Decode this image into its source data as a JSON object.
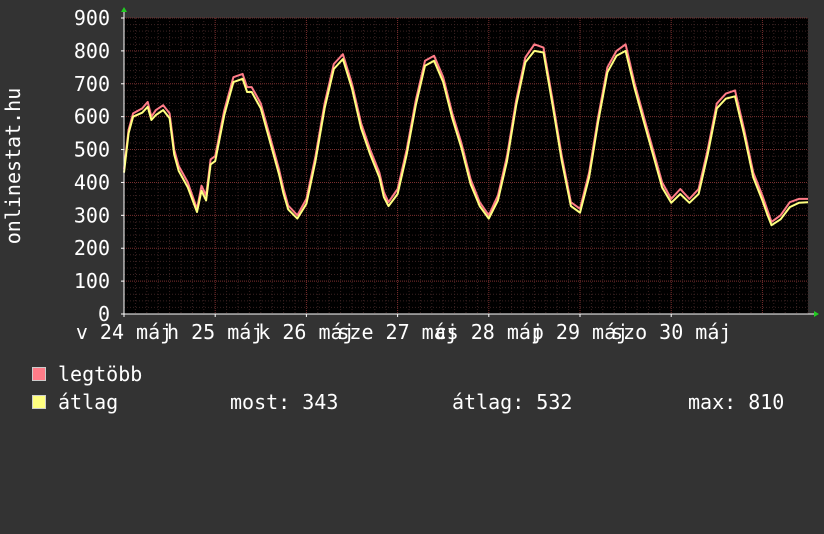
{
  "site_label": "onlinestat.hu",
  "colors": {
    "background": "#333333",
    "plot_background": "#000000",
    "grid": "#4a2626",
    "axis": "#ffffff",
    "max_line": "#ff7c88",
    "avg_line": "#ffff80"
  },
  "legend": [
    {
      "name": "legtöbb",
      "color": "#ff7c88"
    },
    {
      "name": "átlag",
      "color": "#ffff80"
    }
  ],
  "stats": {
    "now": "most: 343",
    "avg": "átlag: 532",
    "max": "max: 810"
  },
  "chart_data": {
    "type": "line",
    "title": "",
    "xlabel": "",
    "ylabel": "onlinestat.hu",
    "ylim": [
      0,
      900
    ],
    "yticks": [
      0,
      100,
      200,
      300,
      400,
      500,
      600,
      700,
      800,
      900
    ],
    "x_day_range": [
      0,
      7.5
    ],
    "xtick_labels": [
      {
        "x": 0,
        "label": "v 24 máj"
      },
      {
        "x": 1,
        "label": "h 25 máj"
      },
      {
        "x": 2,
        "label": "k 26 máj"
      },
      {
        "x": 3,
        "label": "sze 27 máj"
      },
      {
        "x": 4,
        "label": "cs 28 máj"
      },
      {
        "x": 5,
        "label": "p 29 máj"
      },
      {
        "x": 6,
        "label": "szo 30 máj"
      }
    ],
    "grid": true,
    "legend_position": "bottom-left",
    "series": [
      {
        "name": "legtöbb",
        "color": "#ff7c88",
        "x": [
          0.0,
          0.05,
          0.1,
          0.2,
          0.26,
          0.3,
          0.35,
          0.43,
          0.5,
          0.55,
          0.6,
          0.7,
          0.8,
          0.85,
          0.9,
          0.95,
          1.0,
          1.1,
          1.2,
          1.3,
          1.35,
          1.4,
          1.5,
          1.6,
          1.7,
          1.75,
          1.8,
          1.9,
          2.0,
          2.1,
          2.2,
          2.3,
          2.4,
          2.5,
          2.6,
          2.7,
          2.8,
          2.85,
          2.9,
          3.0,
          3.1,
          3.2,
          3.3,
          3.4,
          3.5,
          3.6,
          3.7,
          3.8,
          3.9,
          4.0,
          4.1,
          4.2,
          4.3,
          4.4,
          4.5,
          4.6,
          4.7,
          4.8,
          4.9,
          5.0,
          5.1,
          5.2,
          5.3,
          5.4,
          5.5,
          5.6,
          5.7,
          5.8,
          5.9,
          6.0,
          6.1,
          6.2,
          6.3,
          6.4,
          6.5,
          6.6,
          6.7,
          6.8,
          6.9,
          7.0,
          7.05,
          7.1,
          7.2,
          7.3,
          7.4,
          7.5
        ],
        "y": [
          440,
          560,
          610,
          625,
          645,
          600,
          620,
          635,
          610,
          500,
          450,
          400,
          320,
          390,
          360,
          470,
          480,
          620,
          720,
          730,
          690,
          690,
          640,
          540,
          440,
          380,
          330,
          300,
          350,
          480,
          640,
          760,
          790,
          700,
          580,
          500,
          430,
          370,
          340,
          380,
          500,
          650,
          770,
          785,
          720,
          610,
          520,
          410,
          340,
          300,
          360,
          480,
          650,
          780,
          820,
          810,
          650,
          480,
          340,
          320,
          430,
          600,
          750,
          800,
          820,
          700,
          600,
          500,
          400,
          350,
          380,
          350,
          380,
          500,
          640,
          670,
          680,
          560,
          430,
          360,
          320,
          280,
          300,
          340,
          350,
          350
        ]
      },
      {
        "name": "átlag",
        "color": "#ffff80",
        "x": [
          0.0,
          0.05,
          0.1,
          0.2,
          0.26,
          0.3,
          0.35,
          0.43,
          0.5,
          0.55,
          0.6,
          0.7,
          0.8,
          0.85,
          0.9,
          0.95,
          1.0,
          1.1,
          1.2,
          1.3,
          1.35,
          1.4,
          1.5,
          1.6,
          1.7,
          1.75,
          1.8,
          1.9,
          2.0,
          2.1,
          2.2,
          2.3,
          2.4,
          2.5,
          2.6,
          2.7,
          2.8,
          2.85,
          2.9,
          3.0,
          3.1,
          3.2,
          3.3,
          3.4,
          3.5,
          3.6,
          3.7,
          3.8,
          3.9,
          4.0,
          4.1,
          4.2,
          4.3,
          4.4,
          4.5,
          4.6,
          4.7,
          4.8,
          4.9,
          5.0,
          5.1,
          5.2,
          5.3,
          5.4,
          5.5,
          5.6,
          5.7,
          5.8,
          5.9,
          6.0,
          6.1,
          6.2,
          6.3,
          6.4,
          6.5,
          6.6,
          6.7,
          6.8,
          6.9,
          7.0,
          7.05,
          7.1,
          7.2,
          7.3,
          7.4,
          7.5
        ],
        "y": [
          430,
          550,
          600,
          612,
          630,
          590,
          605,
          620,
          595,
          485,
          435,
          385,
          310,
          375,
          345,
          455,
          465,
          605,
          705,
          715,
          675,
          675,
          625,
          525,
          425,
          365,
          318,
          290,
          335,
          465,
          625,
          745,
          775,
          685,
          565,
          485,
          415,
          355,
          328,
          365,
          485,
          635,
          755,
          770,
          705,
          595,
          505,
          395,
          328,
          290,
          345,
          465,
          635,
          765,
          800,
          795,
          635,
          465,
          328,
          308,
          415,
          585,
          735,
          785,
          800,
          685,
          585,
          485,
          385,
          338,
          365,
          338,
          365,
          485,
          625,
          655,
          662,
          545,
          415,
          345,
          305,
          270,
          288,
          325,
          338,
          340
        ]
      }
    ]
  }
}
